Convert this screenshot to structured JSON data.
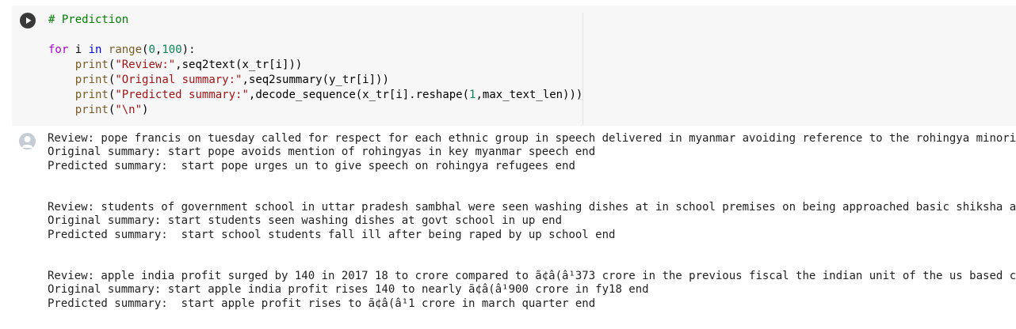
{
  "code_cell": {
    "run_button_icon": "play-icon",
    "lines": [
      [
        {
          "cls": "tok-comment",
          "t": "# Prediction"
        }
      ],
      [],
      [
        {
          "cls": "tok-kw",
          "t": "for"
        },
        {
          "cls": "tok-plain",
          "t": " i "
        },
        {
          "cls": "tok-kw2",
          "t": "in"
        },
        {
          "cls": "tok-plain",
          "t": " "
        },
        {
          "cls": "tok-builtin",
          "t": "range"
        },
        {
          "cls": "tok-plain",
          "t": "("
        },
        {
          "cls": "tok-num",
          "t": "0"
        },
        {
          "cls": "tok-plain",
          "t": ","
        },
        {
          "cls": "tok-num",
          "t": "100"
        },
        {
          "cls": "tok-plain",
          "t": "):"
        }
      ],
      [
        {
          "cls": "tok-plain",
          "t": "    "
        },
        {
          "cls": "tok-builtin",
          "t": "print"
        },
        {
          "cls": "tok-plain",
          "t": "("
        },
        {
          "cls": "tok-str",
          "t": "\"Review:\""
        },
        {
          "cls": "tok-plain",
          "t": ",seq2text(x_tr[i]))"
        }
      ],
      [
        {
          "cls": "tok-plain",
          "t": "    "
        },
        {
          "cls": "tok-builtin",
          "t": "print"
        },
        {
          "cls": "tok-plain",
          "t": "("
        },
        {
          "cls": "tok-str",
          "t": "\"Original summary:\""
        },
        {
          "cls": "tok-plain",
          "t": ",seq2summary(y_tr[i]))"
        }
      ],
      [
        {
          "cls": "tok-plain",
          "t": "    "
        },
        {
          "cls": "tok-builtin",
          "t": "print"
        },
        {
          "cls": "tok-plain",
          "t": "("
        },
        {
          "cls": "tok-str",
          "t": "\"Predicted summary:\""
        },
        {
          "cls": "tok-plain",
          "t": ",decode_sequence(x_tr[i].reshape("
        },
        {
          "cls": "tok-num",
          "t": "1"
        },
        {
          "cls": "tok-plain",
          "t": ",max_text_len)))"
        }
      ],
      [
        {
          "cls": "tok-plain",
          "t": "    "
        },
        {
          "cls": "tok-builtin",
          "t": "print"
        },
        {
          "cls": "tok-plain",
          "t": "("
        },
        {
          "cls": "tok-str",
          "t": "\"\\n\""
        },
        {
          "cls": "tok-plain",
          "t": ")"
        }
      ]
    ]
  },
  "output": {
    "icon": "user-avatar-icon",
    "lines": [
      "Review: pope francis on tuesday called for respect for each ethnic group in speech delivered in myanmar avoiding reference to the rohingya minority",
      "Original summary: start pope avoids mention of rohingyas in key myanmar speech end",
      "Predicted summary:  start pope urges un to give speech on rohingya refugees end",
      "",
      "",
      "Review: students of government school in uttar pradesh sambhal were seen washing dishes at in school premises on being approached basic shiksha adhikari",
      "Original summary: start students seen washing dishes at govt school in up end",
      "Predicted summary:  start school students fall ill after being raped by up school end",
      "",
      "",
      "Review: apple india profit surged by 140 in 2017 18 to crore compared to ã¢â(â¹373 crore in the previous fiscal the indian unit of the us based company",
      "Original summary: start apple india profit rises 140 to nearly ã¢â(â¹900 crore in fy18 end",
      "Predicted summary:  start apple profit rises to ã¢â(â¹1 crore in march quarter end",
      "",
      ""
    ]
  }
}
